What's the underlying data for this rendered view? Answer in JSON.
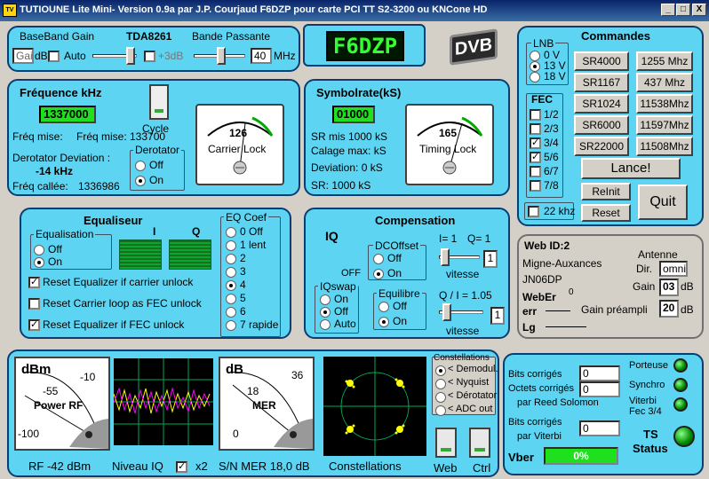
{
  "window": {
    "title": "TUTIOUNE Lite Mini-  Version 0.9a par J.P. Courjaud F6DZP  pour carte PCI TT S2-3200 ou KNCone HD",
    "min": "_",
    "max": "□",
    "close": "X"
  },
  "baseband": {
    "gain_label": "BaseBand Gain",
    "chip": "TDA8261",
    "bw_label": "Bande Passante",
    "gain_value": "Gai",
    "gain_unit": "dB",
    "auto_label": "Auto",
    "plus3db_label": "+3dB",
    "bw_value": "40",
    "bw_unit": "MHz"
  },
  "display": {
    "callsign": "F6DZP",
    "logo": "DVB"
  },
  "freq": {
    "title": "Fréquence kHz",
    "value": "1337000",
    "mise_label": "Fréq mise:",
    "mise_value": "Fréq mise: 1337000",
    "cycle_label": "Cycle",
    "derot_label": "Derotator Deviation :",
    "derot_value": "-14 kHz",
    "called_label": "Fréq callée:",
    "called_value": "1336986",
    "derotator_group": "Derotator",
    "off": "Off",
    "on": "On",
    "meter_value": "126",
    "meter_label": "Carrier Lock"
  },
  "sr": {
    "title": "Symbolrate(kS)",
    "value": "01000",
    "sr_mis": "SR mis  1000 kS",
    "calage": "Calage max:  kS",
    "deviation": "Deviation:  0 kS",
    "sr": "SR:   1000 kS",
    "meter_value": "165",
    "meter_label": "Timing Lock"
  },
  "commandes": {
    "title": "Commandes",
    "lnb_label": "LNB",
    "lnb": [
      "0 V",
      "13 V",
      "18 V"
    ],
    "sr_buttons": [
      "SR4000",
      "SR1167",
      "SR1024",
      "SR6000",
      "SR22000"
    ],
    "freq_buttons": [
      "1255 Mhz",
      "437 Mhz",
      "11538Mhz",
      "11597Mhz",
      "11508Mhz"
    ],
    "fec_label": "FEC",
    "fec": [
      "1/2",
      "2/3",
      "3/4",
      "5/6",
      "6/7",
      "7/8"
    ],
    "lance": "Lance!",
    "reinit": "ReInit",
    "reset": "Reset",
    "quit": "Quit",
    "khz22": "22 khz"
  },
  "eq": {
    "title": "Equaliseur",
    "group": "Equalisation",
    "off": "Off",
    "on": "On",
    "i": "I",
    "q": "Q",
    "reset1": "Reset Equalizer if carrier unlock",
    "reset2": "Reset Carrier loop as FEC unlock",
    "reset3": "Reset Equalizer if FEC unlock",
    "coef_label": "EQ Coef",
    "coefs": [
      "0 Off",
      "1 lent",
      "2",
      "3",
      "4",
      "5",
      "6",
      "7 rapide"
    ]
  },
  "comp": {
    "title": "Compensation",
    "iq": "IQ",
    "dcoffset": "DCOffset",
    "off": "Off",
    "on": "On",
    "i_eq": "I= 1",
    "q_eq": "Q= 1",
    "vitesse": "vitesse",
    "spin1": "1",
    "off_label": "OFF",
    "iqswap": "IQswap",
    "on2": "On",
    "off2": "Off",
    "auto": "Auto",
    "equilibre": "Equilibre",
    "qi": "Q / I =  1.05",
    "spin2": "1"
  },
  "web": {
    "id": "Web ID:2",
    "loc": "Migne-Auxances",
    "grid": "JN06DP",
    "antenne": "Antenne",
    "dir_label": "Dir.",
    "dir_value": "omni",
    "gain_label": "Gain",
    "gain_value": "03",
    "gain_unit": "dB",
    "weberr": "WebEr",
    "err": "err",
    "zero": "0",
    "lg": "Lg",
    "preampli_label": "Gain préampli",
    "preampli_value": "20",
    "preampli_unit": "dB"
  },
  "bottom": {
    "dbm": "dBm",
    "m55": "-55",
    "m10": "-10",
    "m100": "-100",
    "power_rf": "Power RF",
    "db": "dB",
    "v36": "36",
    "v18": "18",
    "v0": "0",
    "mer": "MER",
    "rf": "RF -42 dBm",
    "niveau": "Niveau IQ",
    "x2": "x2",
    "sn": "S/N MER 18,0 dB",
    "constellations": "Constellations",
    "const_group": "Constellations",
    "modes": [
      "< Demodul.",
      "< Nyquist",
      "< Dérotator",
      "< ADC out"
    ],
    "web_label": "Web",
    "ctrl_label": "Ctrl"
  },
  "stats": {
    "bits_rs": "Bits corrigés",
    "octets_rs": "Octets corrigés",
    "par_rs": "par Reed Solomon",
    "bits_rs_v": "0",
    "octets_rs_v": "0",
    "bits_vit": "Bits corrigés",
    "par_vit": "par Viterbi",
    "bits_vit_v": "0",
    "vber": "Vber",
    "vber_value": "0%",
    "porteuse": "Porteuse",
    "synchro": "Synchro",
    "viterbi": "Viterbi",
    "fec": "Fec  3/4",
    "ts": "TS",
    "status": "Status"
  }
}
